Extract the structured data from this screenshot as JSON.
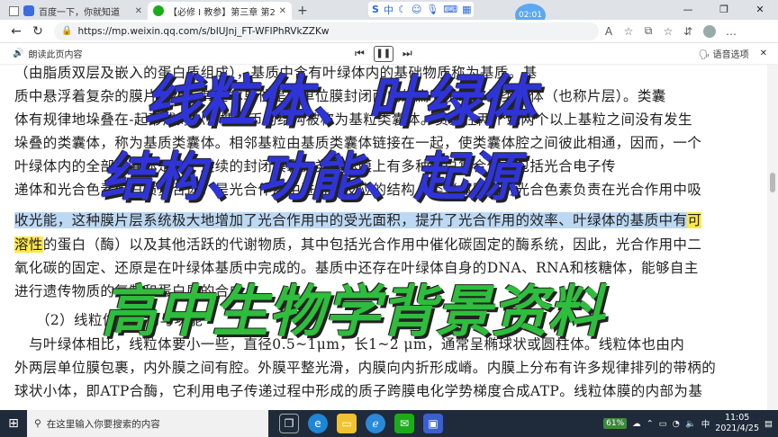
{
  "browser": {
    "tabs": [
      {
        "title": "百度一下，你就知道",
        "active": false
      },
      {
        "title": "【必修 I 教参】第三章 第2节 细",
        "active": true
      }
    ],
    "ime": {
      "label": "中"
    },
    "clock_bubble": "02:01",
    "url": "https://mp.weixin.qq.com/s/bIUJnj_FT-WFIPhRVkZZKw",
    "reader_label": "朗读此页内容",
    "voice_options": "语音选项"
  },
  "article": {
    "lines": [
      {
        "segments": [
          {
            "text": "（由脂质双层及嵌入的蛋白质组成），基质中含有叶绿体内的基础物质称为基质。基",
            "hl": ""
          }
        ]
      },
      {
        "segments": [
          {
            "text": "质中悬浮着复杂的膜片系统，其基本单位是中单位膜封闭而成的扁平小囊称为类囊体（也称片层）。类囊",
            "hl": ""
          }
        ]
      },
      {
        "segments": [
          {
            "text": "体有规律地垛叠在-起形成好似一摞硬币的结构被称为基粒类囊体。贯穿在两个或两个以上基粒之间没有发生",
            "hl": ""
          }
        ]
      },
      {
        "segments": [
          {
            "text": "垛叠的类囊体，称为基质类囊体。相邻基粒由基质类囊体链接在一起，使类囊体腔之间彼此相通，因而，一个",
            "hl": ""
          }
        ]
      },
      {
        "segments": [
          {
            "text": "叶绿体内的全部类囊体是一个连续的封闭膜囊。类囊体膜上有多种蛋白复合体，包括光合电子传",
            "hl": ""
          }
        ]
      },
      {
        "segments": [
          {
            "text": "递体和光合色素蛋白质复合体，是光合作用中进行光反应的结构。类囊体膜上的光合色素负责在光合作用中吸",
            "hl": ""
          }
        ]
      },
      {
        "segments": [
          {
            "text": "收光能，这种膜片层系统极大地增加了光合作用中的受光面积，提升了光合作用的效率、叶绿体的基质中有",
            "hl": "blue"
          },
          {
            "text": "可",
            "hl": "yellow"
          }
        ]
      },
      {
        "segments": [
          {
            "text": "溶性",
            "hl": "yellow"
          },
          {
            "text": "的蛋白（酶）以及其他活跃的代谢物质，其中包括光合作用中催化碳固定的酶系统，因此，光合作用中二",
            "hl": ""
          }
        ]
      },
      {
        "segments": [
          {
            "text": "氧化碳的固定、还原是在叶绿体基质中完成的。基质中还存在叶绿体自身的DNA、RNA和核糖体，能够自主",
            "hl": ""
          }
        ]
      },
      {
        "segments": [
          {
            "text": "进行遗传物质的复制和蛋白质的合成。",
            "hl": ""
          }
        ]
      },
      {
        "segments": [
          {
            "text": "（2）线粒体的结构与功能",
            "hl": ""
          }
        ]
      },
      {
        "segments": [
          {
            "text": "与叶绿体相比，线粒体要小一些，直径0.5~1μm，长1~2 μm，通常呈椭球状或圆柱体。线粒体也由内",
            "hl": ""
          }
        ]
      },
      {
        "segments": [
          {
            "text": "外两层单位膜包裹，内外膜之间有腔。外膜平整光滑，内膜向内折形成嵴。内膜上分布有许多规律排列的带柄的",
            "hl": ""
          }
        ]
      },
      {
        "segments": [
          {
            "text": "球状小体，即ATP合酶，它利用电子传递过程中形成的质子跨膜电化学势梯度合成ATP。线粒体膜的内部为基",
            "hl": ""
          }
        ]
      }
    ]
  },
  "overlay": {
    "title1": "线粒体、叶绿体",
    "title2": "结构、功能、起源",
    "title3": "高中生物学背景资料"
  },
  "taskbar": {
    "search_placeholder": "在这里输入你要搜索的内容",
    "battery": "61%",
    "time": "11:05",
    "date": "2021/4/25"
  }
}
